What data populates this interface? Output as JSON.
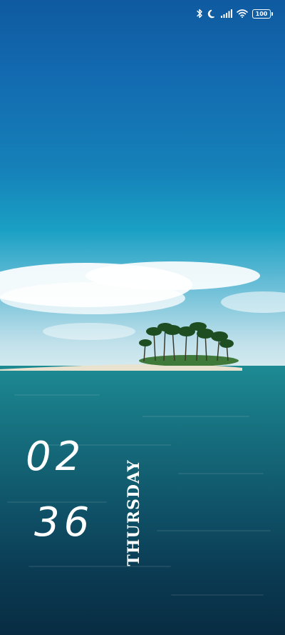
{
  "status_bar": {
    "icons": [
      "bluetooth-icon",
      "moon-icon",
      "signal-icon",
      "wifi-icon",
      "battery-icon"
    ],
    "battery_level": "100"
  },
  "lock_screen": {
    "clock": {
      "hour": "02",
      "minute": "36"
    },
    "day": "THURSDAY"
  },
  "wallpaper": {
    "colors": {
      "sky_top": "#0f5aa0",
      "sky_mid": "#1aa0c4",
      "sea_top": "#1d8b93",
      "sea_bottom": "#082c42"
    }
  }
}
